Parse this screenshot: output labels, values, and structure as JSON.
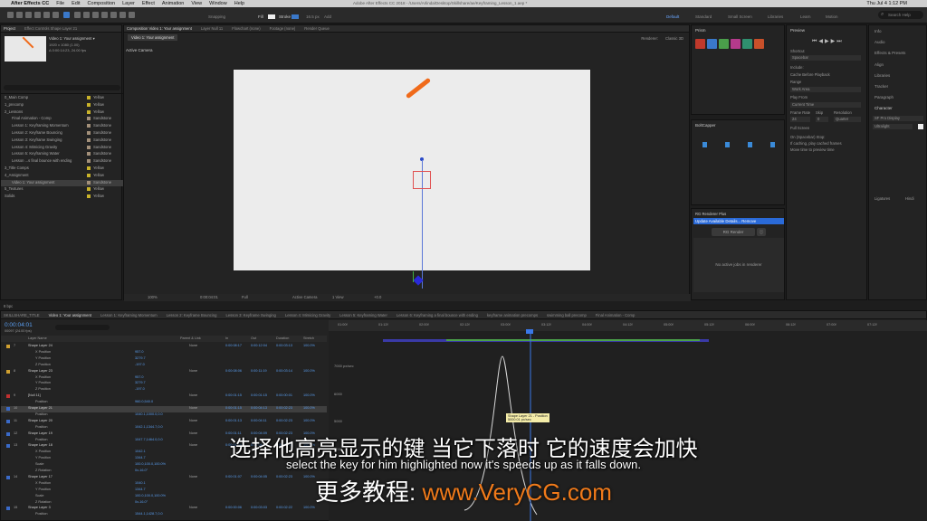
{
  "menubar": {
    "app": "After Effects CC",
    "items": [
      "File",
      "Edit",
      "Composition",
      "Layer",
      "Effect",
      "Animation",
      "View",
      "Window",
      "Help"
    ],
    "path": "Adobe After Effects CC 2018 - /Users/Arlinda/Desktop/Skillshare/ae/Keyframing_Lesson_1.aep *",
    "clock": "Thu Jul 4  1:12 PM"
  },
  "toolbar": {
    "snapping": "Snapping",
    "fill": "Fill",
    "stroke": "Stroke",
    "stroke_width": "16.5 px",
    "add": "Add",
    "workspaces": [
      "Default",
      "Standard",
      "Small Screen",
      "Libraries",
      "Learn",
      "Motion"
    ],
    "search_placeholder": "Search Help"
  },
  "project": {
    "tabs": [
      "Project",
      "Effect Controls Shape Layer 21"
    ],
    "comp_name": "Video 1: Your assignment ▾",
    "comp_size": "1920 x 1080 (1.00)",
    "comp_dur": "Δ 0:00:14:23, 24.00 fps",
    "items": [
      {
        "name": "0_Main Comp",
        "label": "Yellow",
        "color": "#c9b32a",
        "indent": 0
      },
      {
        "name": "1_precomp",
        "label": "Yellow",
        "color": "#c9b32a",
        "indent": 0
      },
      {
        "name": "2_Lessons",
        "label": "Yellow",
        "color": "#c9b32a",
        "indent": 0
      },
      {
        "name": "Final Animation - Comp",
        "label": "Sandstone",
        "color": "#a3907a",
        "indent": 1
      },
      {
        "name": "Lesson 1: Keyframing Momentum",
        "label": "Sandstone",
        "color": "#a3907a",
        "indent": 1
      },
      {
        "name": "Lesson 2: Keyframe Bouncing",
        "label": "Sandstone",
        "color": "#a3907a",
        "indent": 1
      },
      {
        "name": "Lesson 3: Keyframe Swinging",
        "label": "Sandstone",
        "color": "#a3907a",
        "indent": 1
      },
      {
        "name": "Lesson 4: Mimicing Gravity",
        "label": "Sandstone",
        "color": "#a3907a",
        "indent": 1
      },
      {
        "name": "Lesson 5: Keyframing Water",
        "label": "Sandstone",
        "color": "#a3907a",
        "indent": 1
      },
      {
        "name": "Lesson ...s final bounce with ending",
        "label": "Sandstone",
        "color": "#a3907a",
        "indent": 1
      },
      {
        "name": "3_Title Comps",
        "label": "Yellow",
        "color": "#c9b32a",
        "indent": 0
      },
      {
        "name": "4_Assignment",
        "label": "Yellow",
        "color": "#c9b32a",
        "indent": 0
      },
      {
        "name": "Video 1: Your assignment",
        "label": "Sandstone",
        "color": "#a3907a",
        "indent": 1
      },
      {
        "name": "5_Textures",
        "label": "Yellow",
        "color": "#c9b32a",
        "indent": 0
      },
      {
        "name": "Solids",
        "label": "Yellow",
        "color": "#c9b32a",
        "indent": 0
      }
    ],
    "bpc": "8 bpc"
  },
  "composition": {
    "tabs": [
      "Composition Video 1: Your assignment",
      "Layer Null 11",
      "Flowchart (none)",
      "Footage (none)",
      "Render Queue"
    ],
    "sub_tab": "Video 1: Your assignment",
    "renderer": "Renderer:",
    "renderer_value": "Classic 3D",
    "camera_label": "Active Camera",
    "zoom": "100%",
    "timecode": "0:00:04:01",
    "resolution": "Full",
    "view": "Active Camera",
    "views": "1 View",
    "offset": "+0.0"
  },
  "prism": {
    "title": "Prism",
    "swatch_colors": [
      "#c0392b",
      "#3a78c9",
      "#4a9e4a",
      "#b53a8c",
      "#2f8f6f",
      "#c8502a"
    ]
  },
  "boltcapper": {
    "title": "BoltCapper"
  },
  "rg": {
    "title": "RG Renderer Plus",
    "update_text": "Update Available   Details...   Remove",
    "button": "RG Render",
    "status": "No active jobs in renderer"
  },
  "preview": {
    "title": "Preview",
    "shortcut_label": "Shortcut",
    "shortcut": "Spacebar",
    "include_label": "Include:",
    "cache": "Cache Before Playback",
    "range_label": "Range",
    "range": "Work Area",
    "play_from_label": "Play From",
    "play_from": "Current Time",
    "frame_rate_label": "Frame Rate",
    "skip_label": "Skip",
    "resolution_label": "Resolution",
    "frame_rate": "24",
    "skip": "0",
    "resolution": "Quarter",
    "full_screen": "Full Screen",
    "on_stop": "On (Spacebar) Stop:",
    "if_caching": "If caching, play cached frames",
    "move_time": "Move time to preview time"
  },
  "rightcol": {
    "items": [
      "Info",
      "Audio",
      "Effects & Presets",
      "Align",
      "Libraries",
      "Tracker",
      "Paragraph",
      "Character"
    ],
    "font": "SF Pro Display",
    "style": "Ultralight",
    "ligatures": "Ligatures",
    "hindi": "Hindi"
  },
  "timeline": {
    "tabs": [
      "SKILLSHARE_TITLE",
      "Video 1: Your assignment",
      "Lesson 1: Keyframing Momentum",
      "Lesson 2: Keyframe Bouncing",
      "Lesson 3: Keyframe Swinging",
      "Lesson 4: Mimicing Gravity",
      "Lesson 5: Keyframing Water",
      "Lesson 6: Keyframing a final bounce with ending",
      "keyframe animation precomps",
      "swimming ball precomp",
      "Final Animation - Comp"
    ],
    "timecode": "0:00:04:01",
    "timecode_sub": "00097 (24.00 fps)",
    "headers": {
      "layer_name": "Layer Name",
      "mode": "Parent & Link",
      "in": "In",
      "out": "Out",
      "duration": "Duration",
      "stretch": "Stretch"
    },
    "ruler": [
      "01:00f",
      "01:12f",
      "02:00f",
      "02:12f",
      "03:00f",
      "03:12f",
      "04:00f",
      "04:12f",
      "05:00f",
      "05:12f",
      "06:00f",
      "06:12f",
      "07:00f",
      "07:12f"
    ],
    "graph_values": [
      "7000 px/sec",
      "6000",
      "5000",
      "4000"
    ],
    "tooltip_title": "Shape Layer 21 - Position",
    "tooltip_value": "5000.01 px/sec",
    "layers": [
      {
        "num": "7",
        "name": "Shape Layer 24",
        "kind": "layer",
        "color": "#d0a030",
        "parent": "None",
        "in": "0:00:08:17",
        "out": "0:00:12:04",
        "dur": "0:00:03:13",
        "stretch": "100.0%"
      },
      {
        "num": "",
        "name": "X Position",
        "kind": "prop",
        "value": "957.0"
      },
      {
        "num": "",
        "name": "Y Position",
        "kind": "prop",
        "value": "3279.7"
      },
      {
        "num": "",
        "name": "Z Position",
        "kind": "prop",
        "value": "-197.0"
      },
      {
        "num": "8",
        "name": "Shape Layer 23",
        "kind": "layer",
        "color": "#d0a030",
        "parent": "None",
        "in": "0:00:08:06",
        "out": "0:00:11:19",
        "dur": "0:00:03:14",
        "stretch": "100.0%"
      },
      {
        "num": "",
        "name": "X Position",
        "kind": "prop",
        "value": "957.0"
      },
      {
        "num": "",
        "name": "Y Position",
        "kind": "prop",
        "value": "3279.7"
      },
      {
        "num": "",
        "name": "Z Position",
        "kind": "prop",
        "value": "-197.0"
      },
      {
        "num": "9",
        "name": "[Null 11]",
        "kind": "layer",
        "color": "#c03030",
        "parent": "None",
        "in": "0:00:01:15",
        "out": "0:00:01:15",
        "dur": "0:00:00:01",
        "stretch": "100.0%"
      },
      {
        "num": "",
        "name": "Position",
        "kind": "prop",
        "value": "960.0,540.0"
      },
      {
        "num": "10",
        "name": "Shape Layer 21",
        "kind": "layer",
        "color": "#3a6ac8",
        "parent": "None",
        "in": "0:00:01:15",
        "out": "0:00:04:13",
        "dur": "0:00:02:23",
        "stretch": "100.0%",
        "selected": true
      },
      {
        "num": "",
        "name": "Position",
        "kind": "prop",
        "value": "1040.1,1000.0,0.0"
      },
      {
        "num": "11",
        "name": "Shape Layer 20",
        "kind": "layer",
        "color": "#3a6ac8",
        "parent": "None",
        "in": "0:00:01:13",
        "out": "0:00:04:11",
        "dur": "0:00:02:23",
        "stretch": "100.0%"
      },
      {
        "num": "",
        "name": "Position",
        "kind": "prop",
        "value": "1042.1,1344.7,0.0"
      },
      {
        "num": "12",
        "name": "Shape Layer 19",
        "kind": "layer",
        "color": "#3a6ac8",
        "parent": "None",
        "in": "0:00:01:11",
        "out": "0:00:04:09",
        "dur": "0:00:02:23",
        "stretch": "100.0%"
      },
      {
        "num": "",
        "name": "Position",
        "kind": "prop",
        "value": "1047.7,1464.0,0.0"
      },
      {
        "num": "13",
        "name": "Shape Layer 18",
        "kind": "layer",
        "color": "#3a6ac8",
        "parent": "None",
        "in": "0:00:01:09",
        "out": "0:00:04:07",
        "dur": "0:00:02:23",
        "stretch": "100.0%"
      },
      {
        "num": "",
        "name": "X Position",
        "kind": "prop",
        "value": "1042.1"
      },
      {
        "num": "",
        "name": "Y Position",
        "kind": "prop",
        "value": "1344.7"
      },
      {
        "num": "",
        "name": "Scale",
        "kind": "prop",
        "value": "100.0,100.0,100.0%"
      },
      {
        "num": "",
        "name": "Z Rotation",
        "kind": "prop",
        "value": "0x-16.0°"
      },
      {
        "num": "14",
        "name": "Shape Layer 17",
        "kind": "layer",
        "color": "#3a6ac8",
        "parent": "None",
        "in": "0:00:01:07",
        "out": "0:00:04:05",
        "dur": "0:00:02:23",
        "stretch": "100.0%"
      },
      {
        "num": "",
        "name": "X Position",
        "kind": "prop",
        "value": "1040.1"
      },
      {
        "num": "",
        "name": "Y Position",
        "kind": "prop",
        "value": "1344.7"
      },
      {
        "num": "",
        "name": "Scale",
        "kind": "prop",
        "value": "100.0,100.0,100.0%"
      },
      {
        "num": "",
        "name": "Z Rotation",
        "kind": "prop",
        "value": "0x-16.0°"
      },
      {
        "num": "15",
        "name": "Shape Layer 3",
        "kind": "layer",
        "color": "#3a6ac8",
        "parent": "None",
        "in": "0:00:00:06",
        "out": "0:00:03:03",
        "dur": "0:00:02:22",
        "stretch": "100.0%"
      },
      {
        "num": "",
        "name": "Position",
        "kind": "prop",
        "value": "1544.1,1428.7,0.0"
      }
    ]
  },
  "subtitles": {
    "cn": "选择他高亮显示的键 当它下落时 它的速度会加快",
    "en": "select the key for him highlighted now it's speeds up as it falls down.",
    "url_label": "更多教程:",
    "url": "www.VeryCG.com"
  }
}
